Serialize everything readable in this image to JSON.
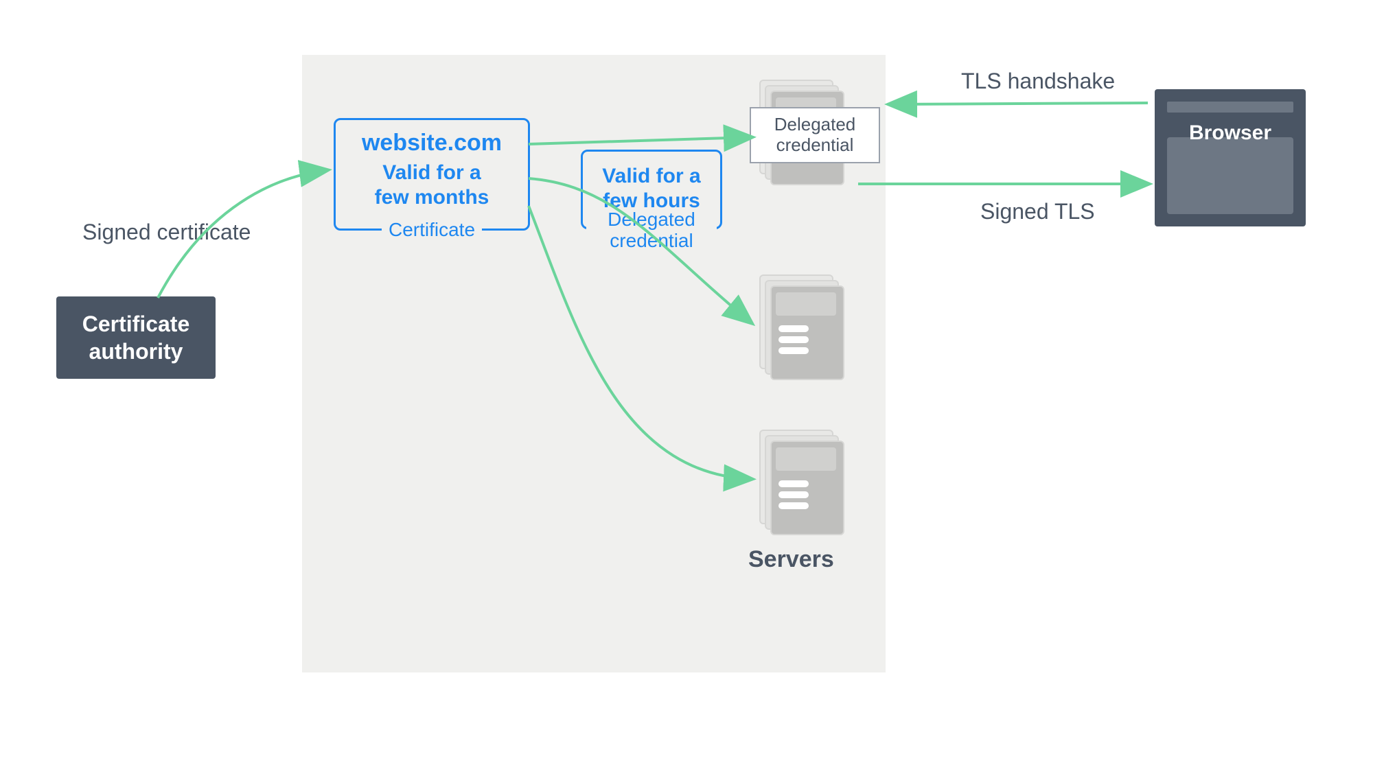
{
  "ca": {
    "label": "Certificate\nauthority"
  },
  "browser": {
    "label": "Browser"
  },
  "certificate": {
    "title": "website.com",
    "subtitle": "Valid for a\nfew months",
    "footer": "Certificate"
  },
  "delegated": {
    "subtitle": "Valid for a\nfew hours",
    "footer": "Delegated\ncredential"
  },
  "popup": {
    "label": "Delegated\ncredential"
  },
  "servers_label": "Servers",
  "labels": {
    "signed_certificate": "Signed certificate",
    "tls_handshake": "TLS handshake",
    "signed_tls": "Signed TLS"
  }
}
